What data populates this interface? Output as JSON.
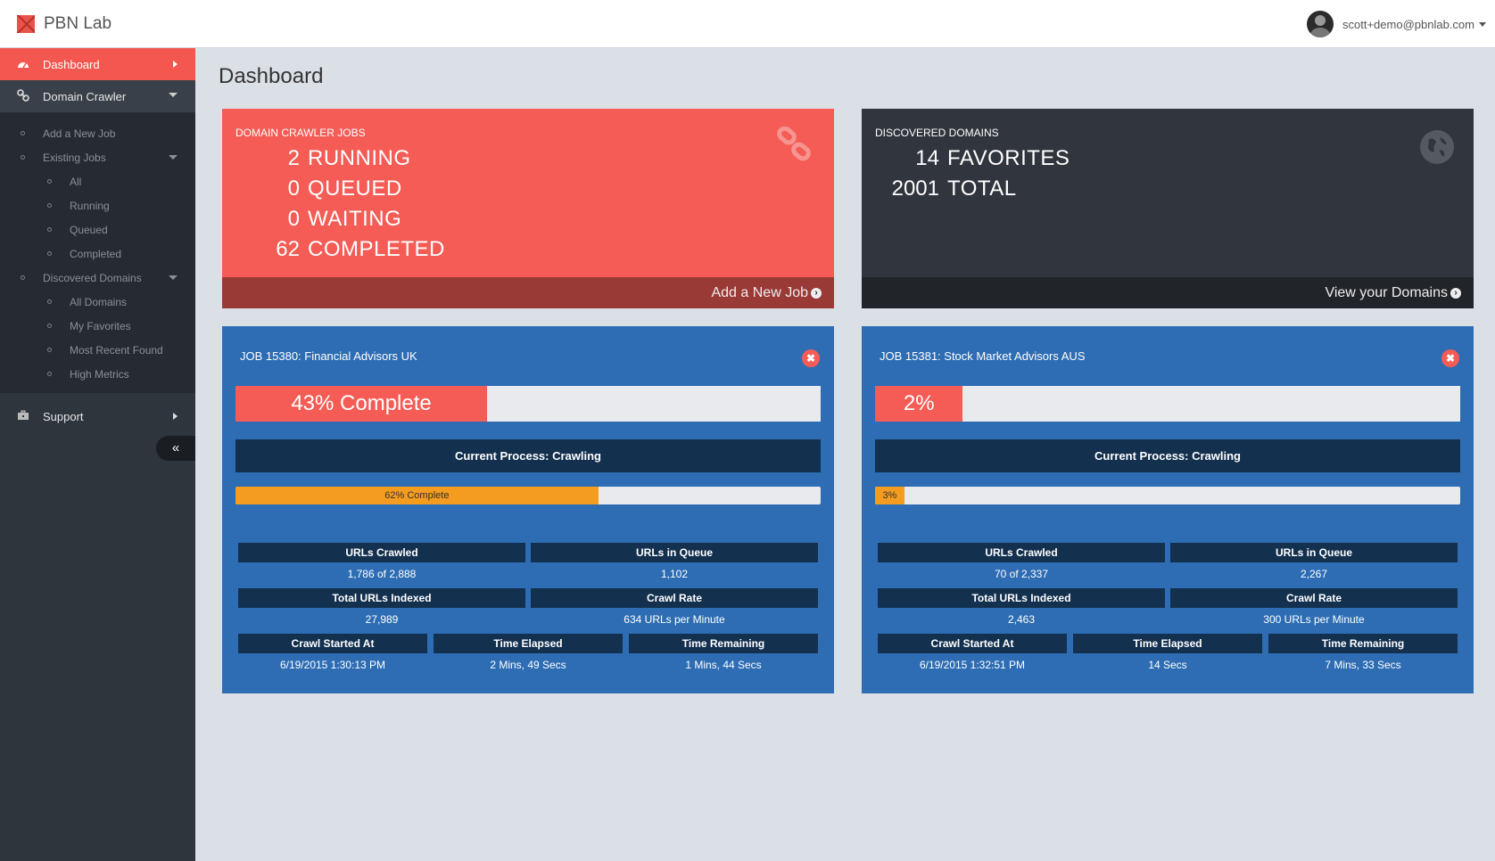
{
  "app": {
    "name": "PBN Lab"
  },
  "user": {
    "email": "scott+demo@pbnlab.com"
  },
  "sidebar": {
    "dashboard": "Dashboard",
    "domain_crawler": "Domain Crawler",
    "add_new_job": "Add a New Job",
    "existing_jobs": "Existing Jobs",
    "jobs_all": "All",
    "jobs_running": "Running",
    "jobs_queued": "Queued",
    "jobs_completed": "Completed",
    "discovered_domains": "Discovered Domains",
    "all_domains": "All Domains",
    "my_favorites": "My Favorites",
    "most_recent_found": "Most Recent Found",
    "high_metrics": "High Metrics",
    "support": "Support"
  },
  "page": {
    "title": "Dashboard"
  },
  "crawler_jobs": {
    "title": "DOMAIN CRAWLER JOBS",
    "running": "2",
    "running_label": "RUNNING",
    "queued": "0",
    "queued_label": "QUEUED",
    "waiting": "0",
    "waiting_label": "WAITING",
    "completed": "62",
    "completed_label": "COMPLETED",
    "footer": "Add a New Job"
  },
  "discovered": {
    "title": "DISCOVERED DOMAINS",
    "favorites": "14",
    "favorites_label": "FAVORITES",
    "total": "2001",
    "total_label": "TOTAL",
    "footer": "View your Domains"
  },
  "jobs": [
    {
      "title": "JOB 15380: Financial Advisors UK",
      "progress_label": "43% Complete",
      "progress": 0.43,
      "process": "Current Process: Crawling",
      "sub_label": "62% Complete",
      "sub_progress": 0.62,
      "urls_crawled_h": "URLs Crawled",
      "urls_crawled": "1,786 of 2,888",
      "urls_queue_h": "URLs in Queue",
      "urls_queue": "1,102",
      "total_indexed_h": "Total URLs Indexed",
      "total_indexed": "27,989",
      "crawl_rate_h": "Crawl Rate",
      "crawl_rate": "634 URLs per Minute",
      "started_h": "Crawl Started At",
      "started": "6/19/2015 1:30:13 PM",
      "elapsed_h": "Time Elapsed",
      "elapsed": "2 Mins, 49 Secs",
      "remaining_h": "Time Remaining",
      "remaining": "1 Mins, 44 Secs"
    },
    {
      "title": "JOB 15381: Stock Market Advisors AUS",
      "progress_label": "2%",
      "progress": 0.15,
      "process": "Current Process: Crawling",
      "sub_label": "3%",
      "sub_progress": 0.05,
      "urls_crawled_h": "URLs Crawled",
      "urls_crawled": "70 of 2,337",
      "urls_queue_h": "URLs in Queue",
      "urls_queue": "2,267",
      "total_indexed_h": "Total URLs Indexed",
      "total_indexed": "2,463",
      "crawl_rate_h": "Crawl Rate",
      "crawl_rate": "300 URLs per Minute",
      "started_h": "Crawl Started At",
      "started": "6/19/2015 1:32:51 PM",
      "elapsed_h": "Time Elapsed",
      "elapsed": "14 Secs",
      "remaining_h": "Time Remaining",
      "remaining": "7 Mins, 33 Secs"
    }
  ],
  "colors": {
    "accent": "#f45c55",
    "sidebar": "#2f353d",
    "job_card": "#2e6db3",
    "dark_panel": "#31353d",
    "orange": "#f39c1f"
  },
  "icons": [
    "dashboard-icon",
    "link-icon",
    "briefcase-icon",
    "double-chevron-left-icon",
    "close-icon",
    "globe-icon",
    "chain-icon",
    "arrow-circle-right-icon"
  ]
}
